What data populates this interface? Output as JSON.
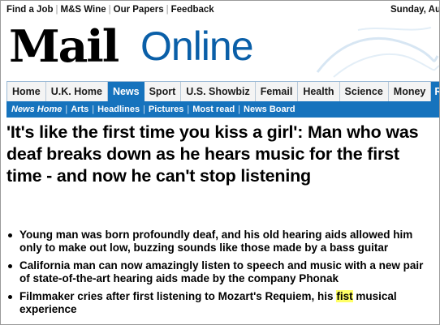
{
  "utility_links": [
    "Find a Job",
    "M&S Wine",
    "Our Papers",
    "Feedback"
  ],
  "date_text": "Sunday, Au",
  "logo": {
    "mail": "Mail",
    "online": "Online"
  },
  "nav": {
    "items": [
      "Home",
      "U.K. Home",
      "News",
      "Sport",
      "U.S. Showbiz",
      "Femail",
      "Health",
      "Science",
      "Money",
      "Ri"
    ],
    "active": "News"
  },
  "subnav": {
    "items": [
      "News Home",
      "Arts",
      "Headlines",
      "Pictures",
      "Most read",
      "News Board"
    ]
  },
  "article": {
    "headline": "'It's like the first time you kiss a girl': Man who was deaf breaks down as he hears music for the first time - and now he can't stop listening",
    "bullets": [
      "Young man was born profoundly deaf, and his old hearing aids allowed him only to make out low, buzzing sounds like those made by a bass guitar",
      "California man can now amazingly listen to speech and music with a new pair of state-of-the-art hearing aids made by the company Phonak"
    ],
    "bullet3": {
      "before": "Filmmaker cries after first listening to Mozart's Requiem, his ",
      "highlight": "fist",
      "after": " musical experience"
    }
  },
  "colors": {
    "brand_blue": "#1673bd",
    "online_blue": "#0a5fa8",
    "highlight": "#ffff66"
  }
}
